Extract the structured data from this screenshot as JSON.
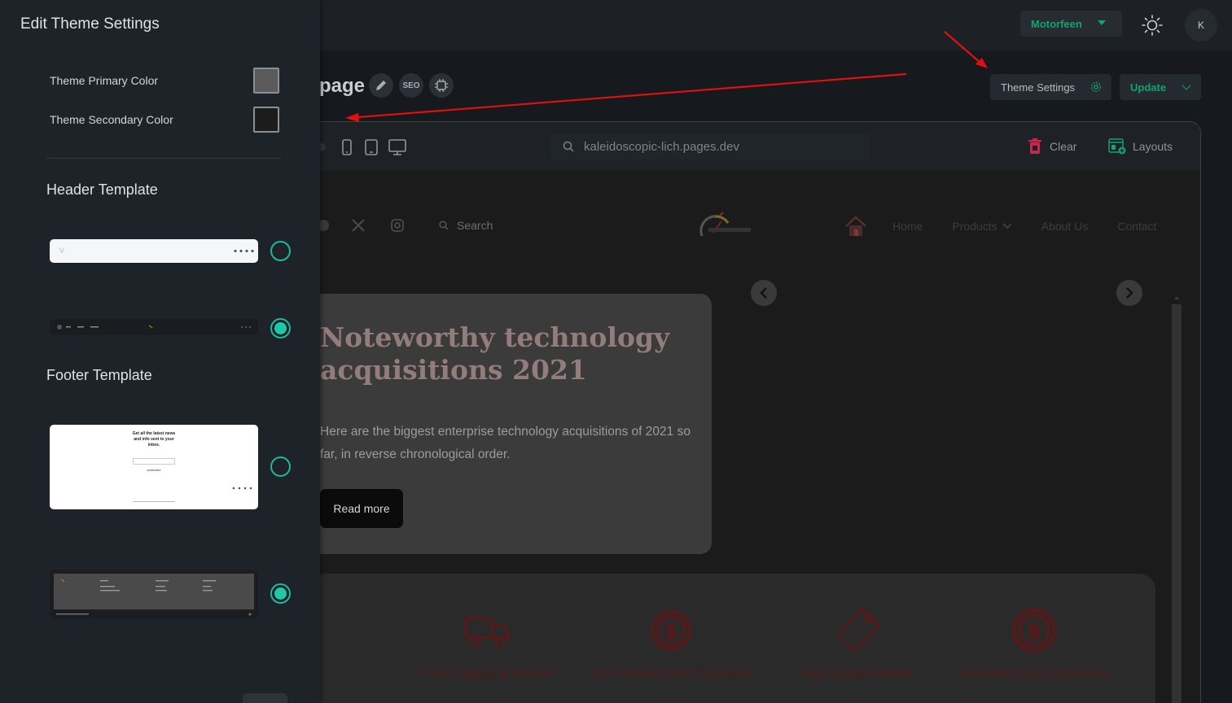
{
  "topbar": {
    "org_select": "Motorfeen",
    "avatar_initial": "K"
  },
  "page": {
    "title": "page",
    "seo_label": "SEO",
    "theme_settings_label": "Theme Settings",
    "update_label": "Update"
  },
  "preview": {
    "url": "kaleidoscopic-lich.pages.dev",
    "clear_label": "Clear",
    "layouts_label": "Layouts"
  },
  "site": {
    "search_label": "Search",
    "nav": [
      "Home",
      "Products",
      "About Us",
      "Contact"
    ],
    "hero": {
      "title": "Noteworthy technology acquisitions 2021",
      "text": "Here are the biggest enterprise technology acquisitions of 2021 so far, in reverse chronological order.",
      "cta": "Read more"
    },
    "features": [
      "Free Shipping & Returns",
      "100% Money Back Guarantee",
      "High Quality Material",
      "Safe and Secure Checkout"
    ]
  },
  "panel": {
    "title": "Edit Theme Settings",
    "primary_color_label": "Theme Primary Color",
    "secondary_color_label": "Theme Secondary Color",
    "primary_color": "#5a5a5a",
    "secondary_color": "#1c1c1c",
    "header_template_title": "Header Template",
    "footer_template_title": "Footer Template",
    "footer_thumb_text": "Get all the latest news and info sent to your inbox.",
    "footer_thumb_button": "subscribe"
  },
  "colors": {
    "accent": "#13a36e",
    "radio": "#1fc8a6",
    "annotation_arrow": "#e01010"
  }
}
